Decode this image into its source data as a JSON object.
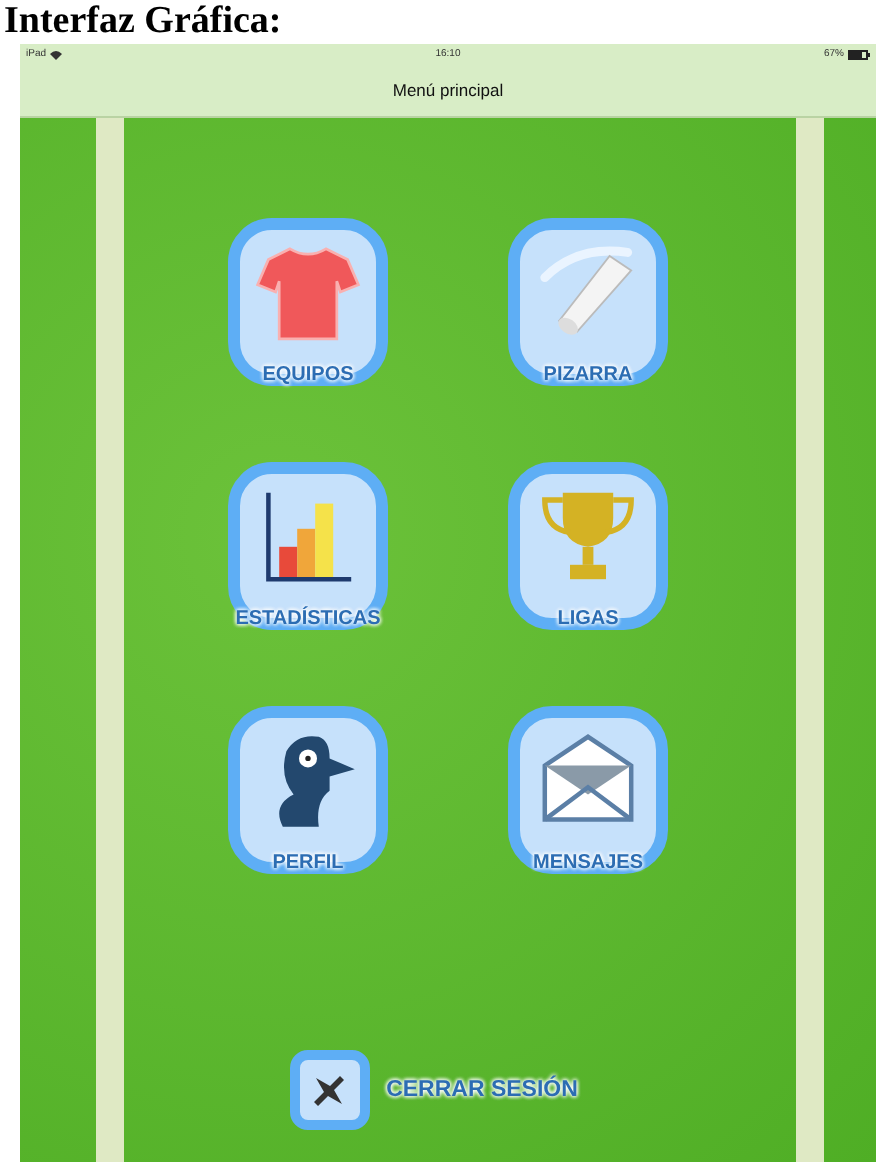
{
  "document_heading": "Interfaz Gráfica:",
  "status_bar": {
    "device": "iPad",
    "time": "16:10",
    "battery": "67%"
  },
  "nav_bar": {
    "title": "Menú principal"
  },
  "menu_items": [
    {
      "label": "EQUIPOS",
      "kind": "shirt"
    },
    {
      "label": "PIZARRA",
      "kind": "chalk"
    },
    {
      "label": "ESTADÍSTICAS",
      "kind": "chart"
    },
    {
      "label": "LIGAS",
      "kind": "trophy"
    },
    {
      "label": "PERFIL",
      "kind": "profile"
    },
    {
      "label": "MENSAJES",
      "kind": "envelope"
    }
  ],
  "logout": {
    "label": "CERRAR SESIÓN"
  }
}
